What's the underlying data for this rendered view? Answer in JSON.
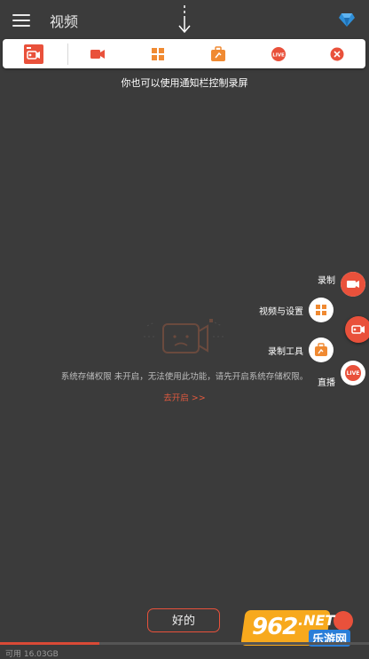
{
  "header": {
    "title": "视频"
  },
  "notification_bar": {
    "items": [
      "recorder-app",
      "record",
      "videos-settings",
      "toolbox",
      "live",
      "close"
    ]
  },
  "hint": "你也可以使用通知栏控制录屏",
  "permission": {
    "message": "系统存储权限 未开启，无法使用此功能，请先开启系统存储权限。",
    "link": "去开启 >>"
  },
  "fab_menu": {
    "record_label": "录制",
    "videos_settings_label": "视频与设置",
    "tools_label": "录制工具",
    "live_label": "直播"
  },
  "ok_button": "好的",
  "storage": {
    "available_text": "可用 16.03GB",
    "used_fraction": 0.27
  },
  "watermark": {
    "number": "962",
    "domain": ".NET",
    "site": "乐游网"
  },
  "colors": {
    "accent": "#e9513b",
    "background": "#3b3b3b"
  }
}
